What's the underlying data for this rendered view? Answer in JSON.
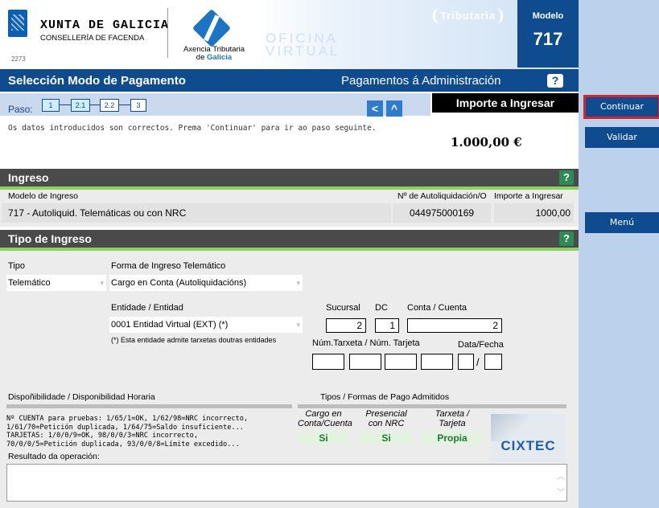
{
  "header": {
    "xunta_title": "XUNTA DE GALICIA",
    "xunta_subtitle": "CONSELLERÍA DE FACENDA",
    "xunta_code": "2273",
    "agency_line1": "Axencia Tributaria",
    "agency_line2_prefix": "de ",
    "agency_line2_name": "Galicia",
    "oficina_line1": "OFICINA",
    "oficina_line2": "VIRTUAL",
    "tributaria": "Tributaria",
    "modelo_label": "Modelo",
    "modelo_number": "717"
  },
  "titlebar": {
    "title": "Selección Modo de Pagamento",
    "subtitle": "Pagamentos á Administración",
    "help": "?"
  },
  "paso": {
    "label": "Paso:",
    "steps": [
      "1",
      "2.1",
      "2.2",
      "3"
    ],
    "back": "<",
    "up": "^"
  },
  "importe": {
    "header": "Importe a Ingresar",
    "value": "1.000,00 €"
  },
  "message": "Os datos introducidos son correctos. Prema 'Continuar' para ir ao paso seguinte.",
  "ingreso": {
    "section_title": "Ingreso",
    "help": "?",
    "col_modelo": "Modelo de Ingreso",
    "col_autoliq": "Nº de Autoliquidación/O",
    "col_importe": "Importe a Ingresar",
    "modelo_value": "717 - Autoliquid. Telemáticas ou con NRC",
    "autoliq_value": "044975000169",
    "importe_value": "1000,00"
  },
  "tipo_ingreso": {
    "section_title": "Tipo de Ingreso",
    "help": "?",
    "tipo_label": "Tipo",
    "tipo_value": "Telemático",
    "forma_label": "Forma de Ingreso Telemático",
    "forma_value": "Cargo en Conta (Autoliquidacións)",
    "entidade_label": "Entidade / Entidad",
    "entidade_value": "0001  Entidad Virtual (EXT) (*)",
    "entidade_note": "(*) Esta entidade admite tarxetas doutras entidades",
    "sucursal_label": "Sucursal",
    "dc_label": "DC",
    "conta_label": "Conta / Cuenta",
    "sucursal_value": "2",
    "dc_value": "1",
    "conta_value": "2",
    "tarxeta_label": "Núm.Tarxeta / Núm. Tarjeta",
    "data_label": "Data/Fecha",
    "data_sep": "/"
  },
  "disponibilidade": {
    "label": "Dispoñibilidade / Disponibilidad Horaria",
    "lines": [
      "Nº CUENTA para pruebas: 1/65/1=OK, 1/62/98=NRC incorrecto,",
      "1/61/70=Petición duplicada, 1/64/75=Saldo insuficiente...",
      "TARJETAS: 1/0/0/9=OK, 98/0/0/3=NRC incorrecto,",
      "70/0/0/5=Petición duplicada, 93/0/0/8=Límite excedido..."
    ]
  },
  "tipos_pago": {
    "label": "Tipos / Formas de Pago Admitidos",
    "cols": [
      {
        "l1": "Cargo en",
        "l2": "Conta/Cuenta",
        "value": "Si"
      },
      {
        "l1": "Presencial",
        "l2": "con NRC",
        "value": "Si"
      },
      {
        "l1": "Tarxeta /",
        "l2": "Tarjeta",
        "value": "Propia"
      }
    ]
  },
  "cixtec": "CIXTEC",
  "resultado_label": "Resultado da operación:",
  "sidebar": {
    "continuar": "Continuar",
    "validar": "Validar",
    "menu": "Menú"
  }
}
